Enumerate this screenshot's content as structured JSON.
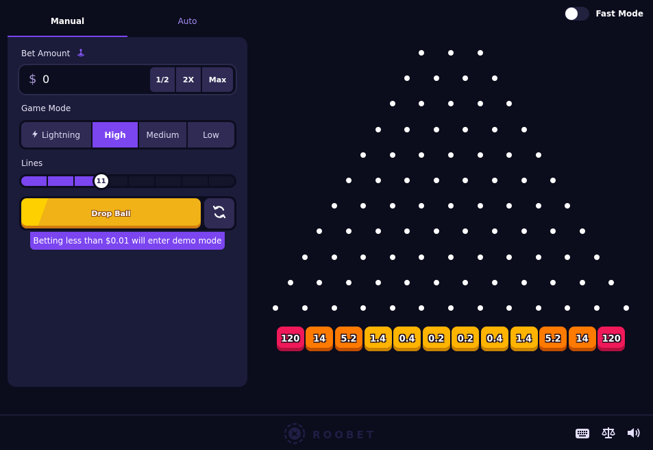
{
  "tabs": [
    {
      "label": "Manual",
      "active": true
    },
    {
      "label": "Auto",
      "active": false
    }
  ],
  "bet": {
    "label": "Bet Amount",
    "label_icon": "joystick-icon",
    "currency_symbol": "$",
    "value": "0",
    "half_label": "1/2",
    "double_label": "2X",
    "max_label": "Max"
  },
  "game_mode": {
    "label": "Game Mode",
    "options": [
      {
        "label": "Lightning",
        "icon": "lightning-bolt-icon",
        "icon_glyph": "ϟ",
        "active": false
      },
      {
        "label": "High",
        "active": true
      },
      {
        "label": "Medium",
        "active": false
      },
      {
        "label": "Low",
        "active": false
      }
    ]
  },
  "lines": {
    "label": "Lines",
    "value": "11",
    "min": 8,
    "max": 16
  },
  "drop_button": {
    "label": "Drop Ball",
    "refresh_icon": "refresh-icon"
  },
  "demo_notice": "Betting less than $0.01 will enter demo mode",
  "fast_mode": {
    "label": "Fast Mode",
    "enabled": false
  },
  "board": {
    "rows": 11,
    "first_row_pins": 3,
    "multipliers": [
      "120",
      "14",
      "5.2",
      "1.4",
      "0.4",
      "0.2",
      "0.2",
      "0.4",
      "1.4",
      "5.2",
      "14",
      "120"
    ],
    "colors": {
      "pin": "#ffffff",
      "slot_high": "#f0195a",
      "slot_mid": "#ff7a00",
      "slot_low": "#ffb400"
    }
  },
  "footer": {
    "brand": "ROOBET",
    "icons": [
      "keyboard-icon",
      "balance-scale-icon",
      "volume-icon"
    ]
  },
  "colors": {
    "accent": "#7b45f0",
    "background": "#0b0c1c",
    "panel": "#1b1b3a",
    "drop_button": "#f0b217"
  }
}
